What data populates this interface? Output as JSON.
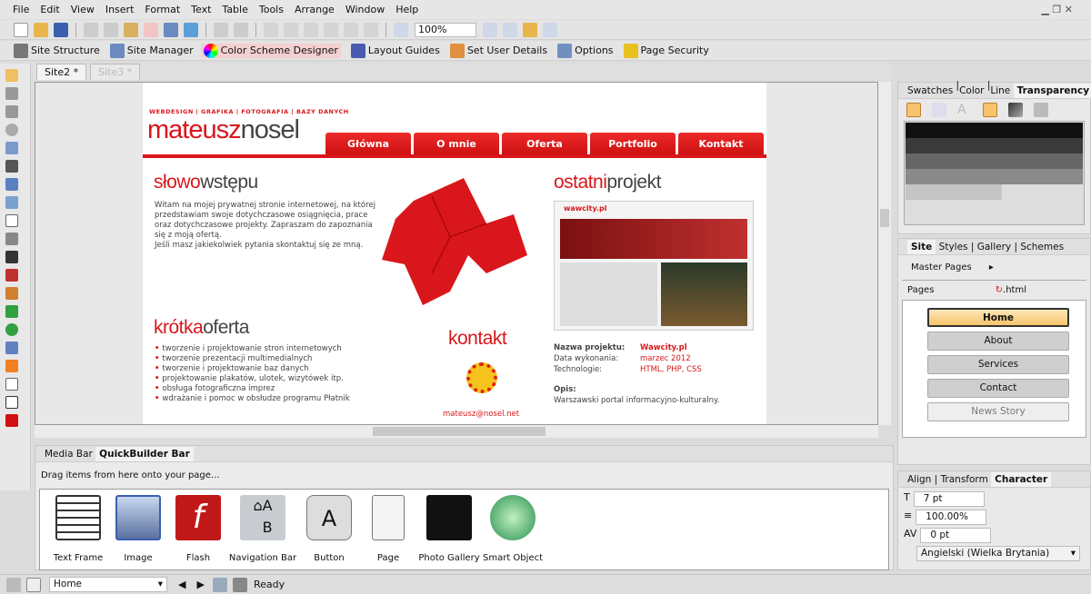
{
  "menu": [
    "File",
    "Edit",
    "View",
    "Insert",
    "Format",
    "Text",
    "Table",
    "Tools",
    "Arrange",
    "Window",
    "Help"
  ],
  "toolbar": {
    "zoom": "100%"
  },
  "toolbar2": [
    "Site Structure",
    "Site Manager",
    "Color Scheme Designer",
    "Layout Guides",
    "Set User Details",
    "Options",
    "Page Security"
  ],
  "doc_tabs": [
    "Site2 *",
    "Site3 *"
  ],
  "site": {
    "topnav": "WEBDESIGN  |  GRAFIKA  |  FOTOGRAFIA  |  BAZY DANYCH",
    "logo_a": "mateusz",
    "logo_b": "nosel",
    "nav": [
      "Główna",
      "O mnie",
      "Oferta",
      "Portfolio",
      "Kontakt"
    ],
    "intro_a": "słowo",
    "intro_b": "wstępu",
    "intro_text": "Witam na mojej prywatnej stronie internetowej, na której przedstawiam swoje dotychczasowe osiągnięcia, prace oraz dotychczasowe projekty. Zapraszam do zapoznania się z moją ofertą.",
    "intro_text2": "Jeśli masz jakiekolwiek pytania skontaktuj się ze mną.",
    "offer_a": "krótka",
    "offer_b": "oferta",
    "offer": [
      "tworzenie i projektowanie stron internetowych",
      "tworzenie prezentacji multimedialnych",
      "tworzenie i projektowanie baz danych",
      "projektowanie plakatów, ulotek, wizytówek itp.",
      "obsługa fotograficzna imprez",
      "wdrażanie i pomoc w obsłudze programu Płatnik"
    ],
    "contact_title": "kontakt",
    "email": "mateusz@nosel.net",
    "project_a": "ostatni",
    "project_b": "projekt",
    "thumb_logo": "wawcity.pl",
    "proj_name_label": "Nazwa projektu:",
    "proj_name": "Wawcity.pl",
    "proj_date_label": "Data wykonania:",
    "proj_date": "marzec 2012",
    "proj_tech_label": "Technologie:",
    "proj_tech": "HTML, PHP, CSS",
    "desc_label": "Opis:",
    "desc": "Warszawski portal informacyjno-kulturalny."
  },
  "swatch_panel": {
    "tabs": [
      "Swatches",
      "Color",
      "Line",
      "Transparency"
    ]
  },
  "site_panel": {
    "tabs": [
      "Site",
      "Styles",
      "Gallery",
      "Schemes"
    ],
    "master": "Master Pages",
    "pages": "Pages",
    "html": ".html",
    "items": [
      "Home",
      "About",
      "Services",
      "Contact",
      "News Story"
    ]
  },
  "char_panel": {
    "tabs": [
      "Align",
      "Transform",
      "Character"
    ],
    "size": "7 pt",
    "leading": "100.00%",
    "tracking": "0 pt",
    "language": "Angielski (Wielka Brytania)"
  },
  "bottom": {
    "tabs": [
      "Media Bar",
      "QuickBuilder Bar"
    ],
    "hint": "Drag items from here onto your page...",
    "items": [
      "Text Frame",
      "Image",
      "Flash",
      "Navigation Bar",
      "Button",
      "Page",
      "Photo Gallery",
      "Smart Object"
    ]
  },
  "status": {
    "page": "Home",
    "text": "Ready"
  },
  "colors": {
    "accent": "#d9161b",
    "highlight": "#f7c46c"
  }
}
